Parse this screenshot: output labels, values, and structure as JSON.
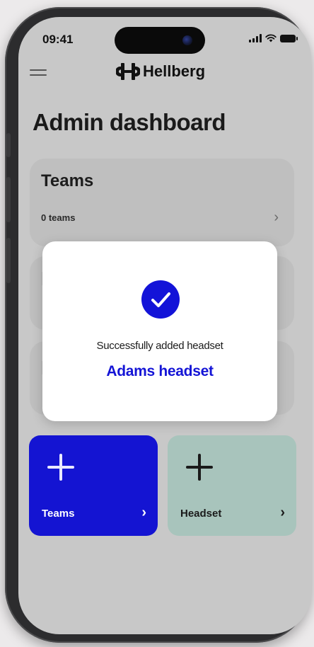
{
  "status_bar": {
    "time": "09:41"
  },
  "header": {
    "brand": "Hellberg"
  },
  "page_title": "Admin dashboard",
  "teams_card": {
    "title": "Teams",
    "count_text": "0 teams"
  },
  "modal": {
    "message": "Successfully added headset",
    "item_name": "Adams headset"
  },
  "actions": [
    {
      "label": "Teams",
      "icon": "plus-icon"
    },
    {
      "label": "Headset",
      "icon": "plus-icon"
    }
  ],
  "colors": {
    "accent": "#1414d2",
    "headset_card": "#a8c4bc",
    "modal_name": "#1414d6"
  }
}
